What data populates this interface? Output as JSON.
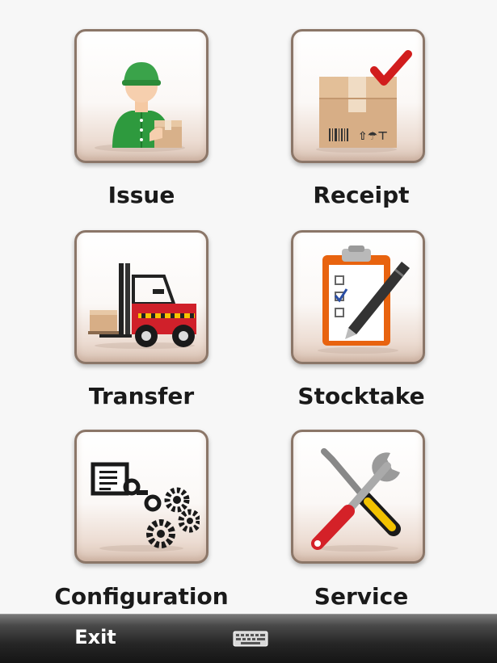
{
  "menu": {
    "items": [
      {
        "label": "Issue"
      },
      {
        "label": "Receipt"
      },
      {
        "label": "Transfer"
      },
      {
        "label": "Stocktake"
      },
      {
        "label": "Configuration"
      },
      {
        "label": "Service"
      }
    ]
  },
  "taskbar": {
    "exit_label": "Exit",
    "keyboard_icon": "keyboard-icon"
  },
  "colors": {
    "tile_border": "#8b7668",
    "taskbar": "#262626",
    "label_text": "#1a1a1a"
  }
}
